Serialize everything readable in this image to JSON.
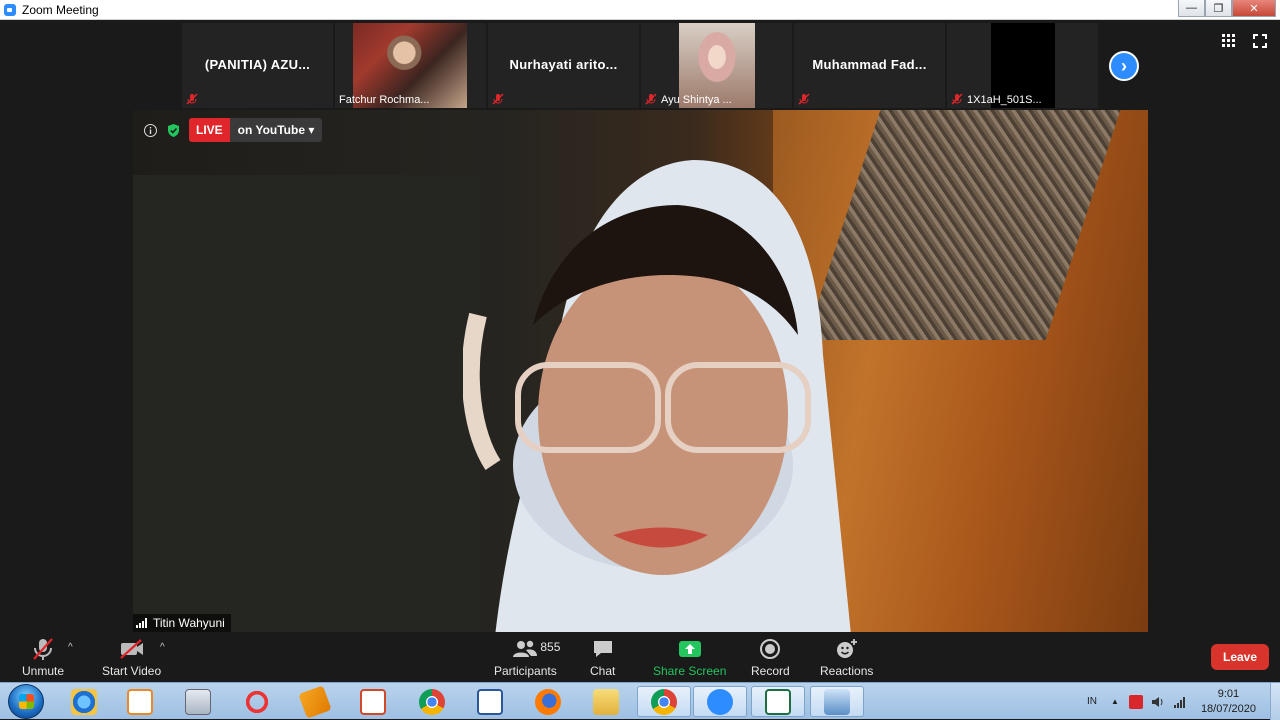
{
  "window": {
    "title": "Zoom Meeting",
    "controls": [
      "—",
      "❐",
      "✕"
    ]
  },
  "participants_strip": [
    {
      "name": "(PANITIA) AZU...",
      "video": false,
      "muted": false
    },
    {
      "name": "Fatchur Rochma...",
      "video": true,
      "muted": false
    },
    {
      "name": "Nurhayati arito...",
      "video": false,
      "muted": true
    },
    {
      "name": "Ayu Shintya ...",
      "video": true,
      "muted": true
    },
    {
      "name": "Muhammad Fad...",
      "video": false,
      "muted": true
    },
    {
      "name": "1X1aH_501S...",
      "video": true,
      "muted": true
    }
  ],
  "main_video": {
    "live_label": "LIVE",
    "stream_target": "on YouTube",
    "speaker_name": "Titin Wahyuni"
  },
  "toolbar": {
    "unmute": "Unmute",
    "start_video": "Start Video",
    "participants": "Participants",
    "participant_count": "855",
    "chat": "Chat",
    "share_screen": "Share Screen",
    "record": "Record",
    "reactions": "Reactions",
    "leave": "Leave"
  },
  "taskbar": {
    "apps": [
      "internet-explorer",
      "media-player",
      "calculator",
      "app-4",
      "app-5",
      "powerpoint",
      "chrome",
      "word",
      "firefox",
      "file-explorer",
      "chrome-active",
      "zoom",
      "excel",
      "remote-desktop"
    ],
    "language": "IN",
    "time": "9:01",
    "date": "18/07/2020"
  },
  "colors": {
    "accent": "#2d8cff",
    "leave": "#d9342b",
    "live": "#e0262b",
    "share": "#22c55e"
  }
}
